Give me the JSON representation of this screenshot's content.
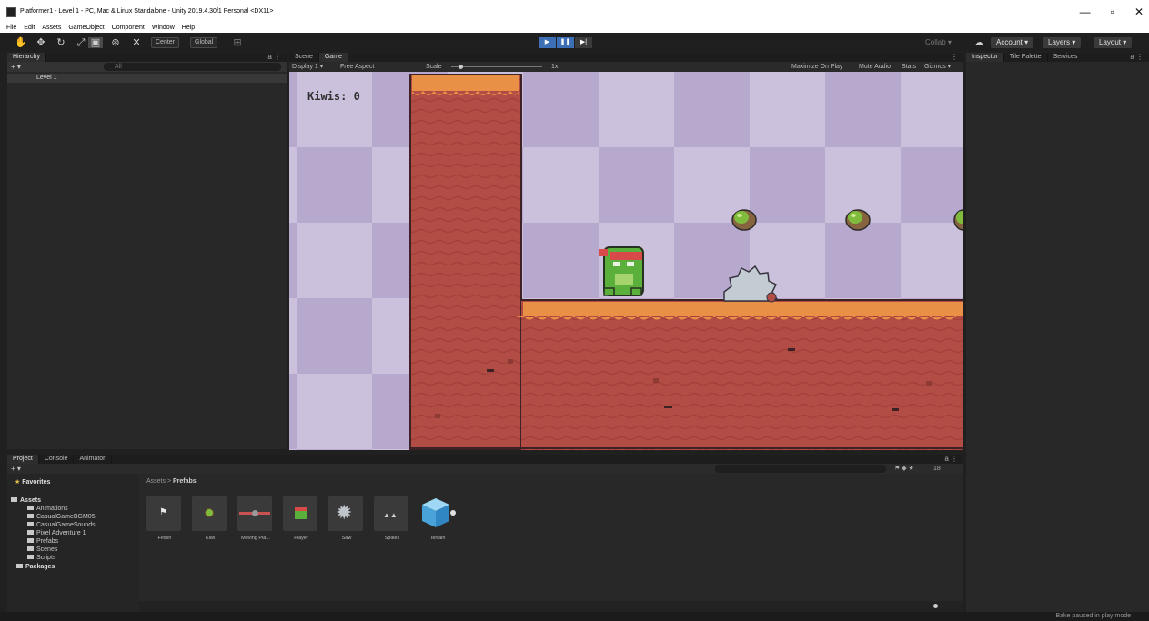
{
  "window": {
    "title": "Platformer1 - Level 1 - PC, Mac & Linux Standalone - Unity 2019.4.30f1 Personal <DX11>",
    "minimize": "—",
    "restore": "▫",
    "close": "✕"
  },
  "menu": [
    "File",
    "Edit",
    "Assets",
    "GameObject",
    "Component",
    "Window",
    "Help"
  ],
  "toolbar": {
    "pivot_center": "Center",
    "pivot_global": "Global",
    "collab": "Collab ▾",
    "account": "Account ▾",
    "layers": "Layers ▾",
    "layout": "Layout ▾"
  },
  "hierarchy": {
    "tab": "Hierarchy",
    "add": "+ ▾",
    "search_placeholder": "All",
    "scene": "Level 1"
  },
  "center_tabs": {
    "scene": "Scene",
    "game": "Game"
  },
  "game_bar": {
    "display": "Display 1 ▾",
    "aspect": "Free Aspect",
    "scale_label": "Scale",
    "scale_value": "1x",
    "maximize": "Maximize On Play",
    "mute": "Mute Audio",
    "stats": "Stats",
    "gizmos": "Gizmos ▾"
  },
  "game": {
    "kiwis_text": "Kiwis: 0"
  },
  "right_tabs": {
    "inspector": "Inspector",
    "tile_palette": "Tile Palette",
    "services": "Services"
  },
  "bottom_tabs": {
    "project": "Project",
    "console": "Console",
    "animator": "Animator"
  },
  "project": {
    "add": "+ ▾",
    "badge": "18",
    "favorites": "Favorites",
    "assets_root": "Assets",
    "folders": [
      "Animations",
      "CasualGameBGM05",
      "CasualGameSounds",
      "Pixel Adventure 1",
      "Prefabs",
      "Scenes",
      "Scripts"
    ],
    "packages": "Packages",
    "breadcrumb_root": "Assets",
    "breadcrumb_current": "Prefabs",
    "assets": [
      "Finish",
      "Kiwi",
      "Moving Pla...",
      "Player",
      "Saw",
      "Spikes",
      "Terrain"
    ]
  },
  "status": {
    "text": "Bake paused in play mode"
  },
  "colors": {
    "play_blue": "#3d6fb6",
    "sky_light": "#c9bedb",
    "sky_dark": "#b5a7cc",
    "terrain": "#b24d45",
    "grass": "#e89045"
  }
}
